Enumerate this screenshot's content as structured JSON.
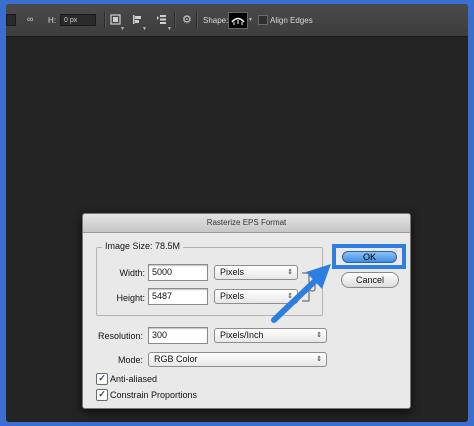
{
  "optionsbar": {
    "h_label": "H:",
    "h_value": "0 px",
    "shape_label": "Shape:",
    "align_edges_label": "Align Edges"
  },
  "dialog": {
    "title": "Rasterize EPS Format",
    "image_size_label": "Image Size: 78.5M",
    "width_label": "Width:",
    "width_value": "5000",
    "width_unit": "Pixels",
    "height_label": "Height:",
    "height_value": "5487",
    "height_unit": "Pixels",
    "resolution_label": "Resolution:",
    "resolution_value": "300",
    "resolution_unit": "Pixels/Inch",
    "mode_label": "Mode:",
    "mode_value": "RGB Color",
    "anti_aliased_label": "Anti-aliased",
    "anti_aliased_checked": true,
    "constrain_label": "Constrain Proportions",
    "constrain_checked": true,
    "ok_label": "OK",
    "cancel_label": "Cancel"
  },
  "colors": {
    "highlight": "#2d7ee0",
    "background": "#242424"
  }
}
